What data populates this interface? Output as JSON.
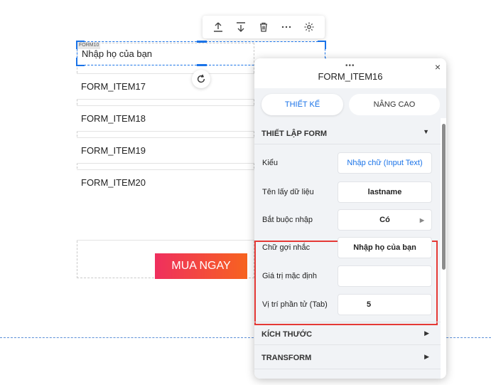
{
  "toolbar": {
    "items": [
      "move-up-icon",
      "move-down-icon",
      "delete-icon",
      "more-icon",
      "settings-icon"
    ]
  },
  "canvas": {
    "selected_tag": "FORM10",
    "selected_placeholder": "Nhập họ của bạn",
    "fields": [
      "FORM_ITEM17",
      "FORM_ITEM18",
      "FORM_ITEM19",
      "FORM_ITEM20"
    ],
    "buy_button": "MUA NGAY"
  },
  "panel": {
    "drag_dots": "•••",
    "title": "FORM_ITEM16",
    "close": "×",
    "tabs": {
      "design": "THIẾT KẾ",
      "advanced": "NÂNG CAO"
    },
    "section_form": "THIẾT LẬP FORM",
    "rows": {
      "type": {
        "label": "Kiểu",
        "value": "Nhập chữ (Input Text)"
      },
      "data_name": {
        "label": "Tên lấy dữ liệu",
        "value": "lastname"
      },
      "required": {
        "label": "Bắt buộc nhập",
        "value": "Có"
      },
      "hint": {
        "label": "Chữ gợi nhắc",
        "value": "Nhập họ của bạn"
      },
      "default": {
        "label": "Giá trị mặc định",
        "value": ""
      },
      "tab_index": {
        "label": "Vị trí phần tử (Tab)",
        "value": "5"
      }
    },
    "section_size": "KÍCH THƯỚC",
    "section_transform": "TRANSFORM"
  },
  "colors": {
    "accent": "#1a73e8",
    "highlight": "#e53935",
    "button_start": "#ef2f5e",
    "button_end": "#f7631f"
  }
}
